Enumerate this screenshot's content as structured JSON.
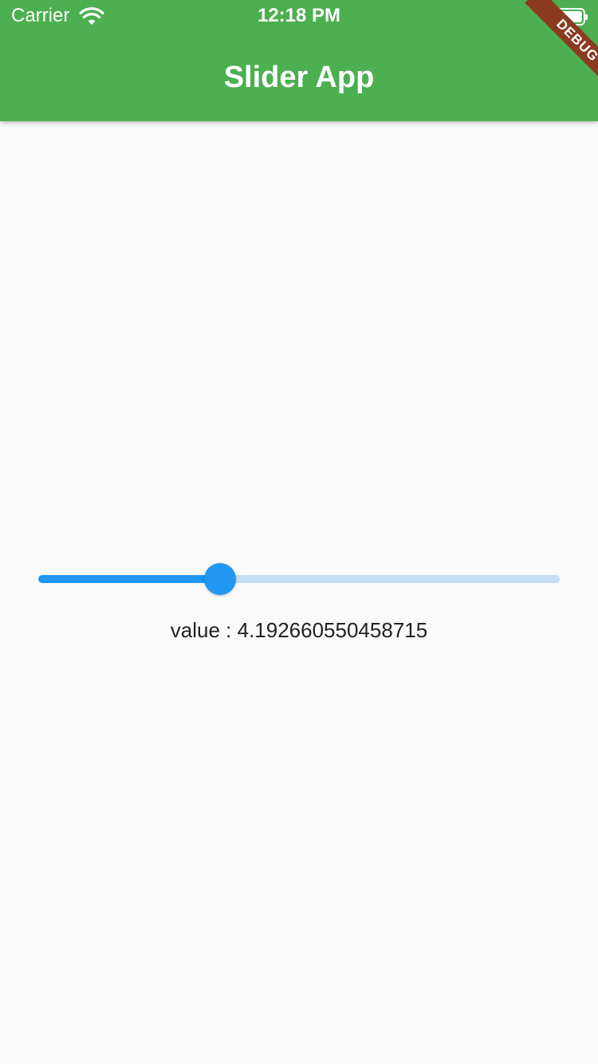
{
  "status_bar": {
    "carrier": "Carrier",
    "time": "12:18 PM",
    "wifi_icon": "wifi-icon",
    "battery_icon": "battery-icon"
  },
  "app_bar": {
    "title": "Slider App",
    "color": "#4caf50"
  },
  "debug_banner": {
    "label": "DEBUG",
    "color": "#8b3a1f"
  },
  "slider": {
    "min": 0,
    "max": 12,
    "value": 4.192660550458715,
    "active_color": "#2196f3",
    "inactive_color": "#c5def4"
  },
  "value_display": {
    "prefix": "value : ",
    "value": "4.192660550458715"
  }
}
